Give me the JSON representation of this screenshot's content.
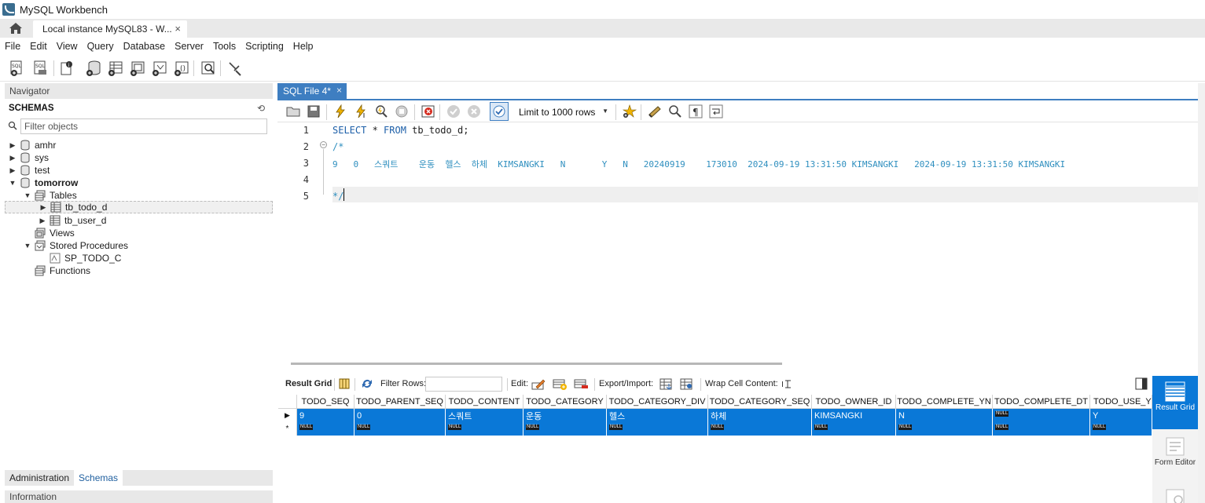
{
  "window": {
    "title": "MySQL Workbench",
    "connection_tab": "Local instance MySQL83 - W...",
    "close_glyph": "×"
  },
  "menu": [
    "File",
    "Edit",
    "View",
    "Query",
    "Database",
    "Server",
    "Tools",
    "Scripting",
    "Help"
  ],
  "navigator": {
    "header": "Navigator",
    "schemas_title": "SCHEMAS",
    "filter_placeholder": "Filter objects",
    "tree": {
      "amhr": "amhr",
      "sys": "sys",
      "test": "test",
      "tomorrow": "tomorrow",
      "tables": "Tables",
      "tb_todo_d": "tb_todo_d",
      "tb_user_d": "tb_user_d",
      "views": "Views",
      "stored_procedures": "Stored Procedures",
      "sp_todo_c": "SP_TODO_C",
      "functions": "Functions"
    },
    "bottom_tabs": [
      "Administration",
      "Schemas"
    ],
    "active_bottom_tab": "Schemas",
    "info_header": "Information"
  },
  "editor": {
    "tab_label": "SQL File 4*",
    "limit_select": "Limit to 1000 rows",
    "line_numbers": [
      "1",
      "2",
      "3",
      "4",
      "5"
    ],
    "line1": {
      "kw1": "SELECT",
      "mid": " * ",
      "kw2": "FROM",
      "rest": " tb_todo_d;"
    },
    "line2": "/*",
    "line3": "9   0   스쿼트    운동  헬스  하체  KIMSANGKI   N       Y   N   20240919    173010  2024-09-19 13:31:50 KIMSANGKI   2024-09-19 13:31:50 KIMSANGKI",
    "line5": "*/"
  },
  "result": {
    "toolbar": {
      "result_grid": "Result Grid",
      "filter_rows": "Filter Rows:",
      "edit": "Edit:",
      "export_import": "Export/Import:",
      "wrap_cell": "Wrap Cell Content:"
    },
    "columns": [
      "TODO_SEQ",
      "TODO_PARENT_SEQ",
      "TODO_CONTENT",
      "TODO_CATEGORY",
      "TODO_CATEGORY_DIV",
      "TODO_CATEGORY_SEQ",
      "TODO_OWNER_ID",
      "TODO_COMPLETE_YN",
      "TODO_COMPLETE_DT",
      "TODO_USE_YN"
    ],
    "row1": [
      "9",
      "0",
      "스쿼트",
      "운동",
      "헬스",
      "하체",
      "KIMSANGKI",
      "N",
      "NULL",
      "Y"
    ],
    "row2": [
      "NULL",
      "NULL",
      "NULL",
      "NULL",
      "NULL",
      "NULL",
      "NULL",
      "NULL",
      "NULL",
      "NULL"
    ],
    "row1_marker": "▶",
    "row2_marker": "*",
    "null_label": "NULL"
  },
  "side_rail": {
    "result_grid": "Result Grid",
    "form_editor": "Form Editor"
  },
  "colors": {
    "accent": "#3e7ec1",
    "selection": "#0a78d7",
    "keyword": "#1c5fa8",
    "comment": "#2f8fbf"
  }
}
